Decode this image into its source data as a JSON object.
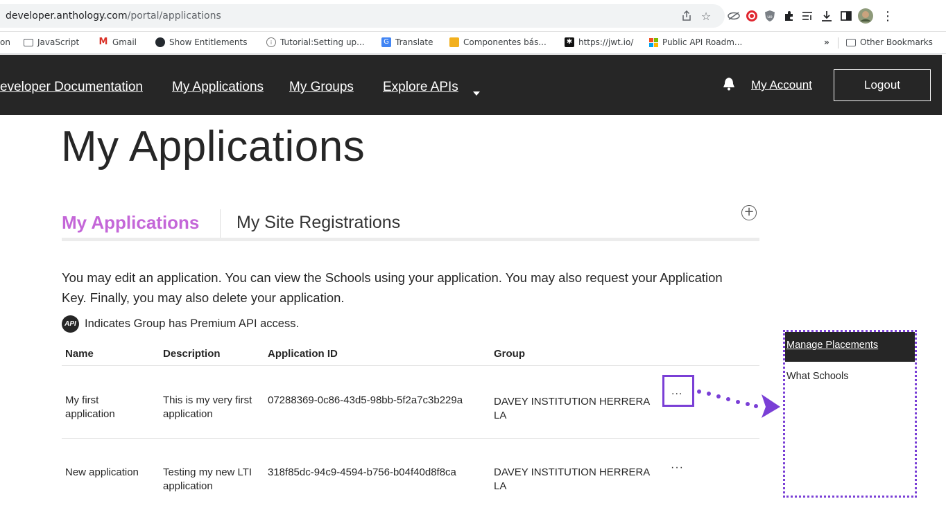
{
  "browser": {
    "url_host": "developer.anthology.com",
    "url_path": "/portal/applications",
    "bookmarks": [
      {
        "label": "on",
        "icon": "truncated-bookmark"
      },
      {
        "label": "JavaScript",
        "icon": "folder-icon"
      },
      {
        "label": "Gmail",
        "icon": "gmail-icon"
      },
      {
        "label": "Show Entitlements",
        "icon": "github-icon"
      },
      {
        "label": "Tutorial:Setting up...",
        "icon": "tutorial-icon"
      },
      {
        "label": "Translate",
        "icon": "translate-icon"
      },
      {
        "label": "Componentes bás...",
        "icon": "components-icon"
      },
      {
        "label": "https://jwt.io/",
        "icon": "jwt-icon"
      },
      {
        "label": "Public API Roadm...",
        "icon": "microsoft-icon"
      }
    ],
    "overflow_label": "»",
    "other_bookmarks": "Other Bookmarks"
  },
  "nav": {
    "links": [
      "eveloper Documentation",
      "My Applications",
      "My Groups",
      "Explore APIs"
    ],
    "my_account": "My Account",
    "logout": "Logout"
  },
  "page": {
    "title": "My Applications",
    "tabs": {
      "active": "My Applications",
      "inactive": "My Site Registrations"
    },
    "add_symbol": "+",
    "description": "You may edit an application. You can view the Schools using your application. You may also request your Application Key. Finally, you may also delete your application.",
    "premium_badge": "API",
    "premium_note": "Indicates Group has Premium API access."
  },
  "table": {
    "headers": [
      "Name",
      "Description",
      "Application ID",
      "Group"
    ],
    "rows": [
      {
        "name": "My first application",
        "description": "This is my very first application",
        "app_id": "07288369-0c86-43d5-98bb-5f2a7c3b229a",
        "group": "DAVEY INSTITUTION HERRERA LA",
        "more": "..."
      },
      {
        "name": "New application",
        "description": "Testing my new LTI application",
        "app_id": "318f85dc-94c9-4594-b756-b04f40d8f8ca",
        "group": "DAVEY INSTITUTION HERRERA LA",
        "more": "···"
      }
    ]
  },
  "menu": {
    "items": [
      "Manage Placements",
      "What Schools"
    ]
  },
  "colors": {
    "accent": "#c466d8",
    "annotation": "#7a3fd6",
    "nav_bg": "#262626"
  }
}
